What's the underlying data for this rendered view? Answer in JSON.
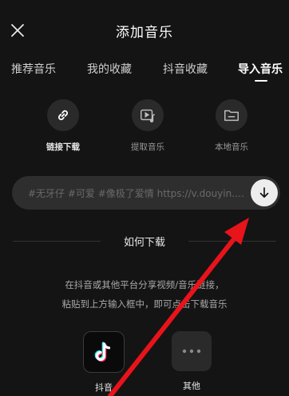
{
  "header": {
    "title": "添加音乐",
    "close_icon": "close-icon"
  },
  "tabs": [
    {
      "label": "推荐音乐",
      "active": false
    },
    {
      "label": "我的收藏",
      "active": false
    },
    {
      "label": "抖音收藏",
      "active": false
    },
    {
      "label": "导入音乐",
      "active": true
    }
  ],
  "options": [
    {
      "label": "链接下载",
      "icon": "link-icon",
      "active": true
    },
    {
      "label": "提取音乐",
      "icon": "video-music-icon",
      "active": false
    },
    {
      "label": "本地音乐",
      "icon": "folder-icon",
      "active": false
    }
  ],
  "link_input": {
    "value": "#无牙仔 #可爱 #像极了爱情 https://v.douyin.c...",
    "download_icon": "download-arrow-icon"
  },
  "how_to": {
    "title": "如何下载",
    "line1": "在抖音或其他平台分享视频/音乐链接，",
    "line2": "粘贴到上方输入框中，即可点击下载音乐"
  },
  "apps": [
    {
      "label": "抖音",
      "icon": "tiktok-icon"
    },
    {
      "label": "其他",
      "icon": "more-dots-icon"
    }
  ],
  "colors": {
    "background": "#141414",
    "annotation_arrow": "#e8131b"
  }
}
